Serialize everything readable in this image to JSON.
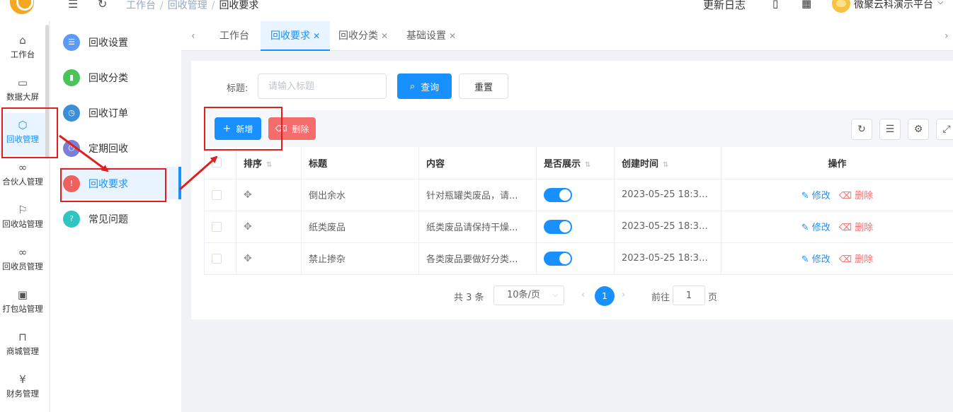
{
  "header": {
    "breadcrumbs": [
      "工作台",
      "回收管理",
      "回收要求"
    ],
    "right_items": {
      "changelog": "更新日志",
      "account": "微聚云科演示平台"
    }
  },
  "leftnav": {
    "items": [
      {
        "label": "工作台",
        "icon": "home-icon"
      },
      {
        "label": "数据大屏",
        "icon": "monitor-icon"
      },
      {
        "label": "回收管理",
        "icon": "cube-icon",
        "active": true
      },
      {
        "label": "合伙人管理",
        "icon": "link-icon"
      },
      {
        "label": "回收站管理",
        "icon": "flag-icon"
      },
      {
        "label": "回收员管理",
        "icon": "infinity-icon"
      },
      {
        "label": "打包站管理",
        "icon": "package-icon"
      },
      {
        "label": "商城管理",
        "icon": "bag-icon"
      },
      {
        "label": "财务管理",
        "icon": "yen-icon"
      }
    ]
  },
  "submenu": {
    "items": [
      {
        "label": "回收设置",
        "icon": "settings-icon",
        "color": "#5b9bf5"
      },
      {
        "label": "回收分类",
        "icon": "bookmark-icon",
        "color": "#4cc25a"
      },
      {
        "label": "回收订单",
        "icon": "clock-icon",
        "color": "#3a8fd8"
      },
      {
        "label": "定期回收",
        "icon": "power-icon",
        "color": "#7b7fd6"
      },
      {
        "label": "回收要求",
        "icon": "alert-icon",
        "color": "#f0605d",
        "active": true
      },
      {
        "label": "常见问题",
        "icon": "question-icon",
        "color": "#2ec5c2"
      }
    ]
  },
  "tabs": [
    {
      "label": "工作台",
      "closable": false
    },
    {
      "label": "回收要求",
      "closable": true,
      "active": true
    },
    {
      "label": "回收分类",
      "closable": true
    },
    {
      "label": "基础设置",
      "closable": true
    }
  ],
  "search": {
    "label": "标题:",
    "placeholder": "请输入标题",
    "query_label": "查询",
    "reset_label": "重置"
  },
  "actions": {
    "add_label": "新增",
    "delete_label": "删除"
  },
  "table": {
    "columns": [
      "排序",
      "标题",
      "内容",
      "是否展示",
      "创建时间",
      "操作"
    ],
    "rows": [
      {
        "title": "倒出余水",
        "content": "针对瓶罐类废品，请...",
        "show": true,
        "created": "2023-05-25 18:32:..."
      },
      {
        "title": "纸类废品",
        "content": "纸类废品请保持干燥...",
        "show": true,
        "created": "2023-05-25 18:30:..."
      },
      {
        "title": "禁止掺杂",
        "content": "各类废品要做好分类...",
        "show": true,
        "created": "2023-05-25 18:31:..."
      }
    ],
    "edit_label": "修改",
    "row_delete_label": "删除"
  },
  "pagination": {
    "total_text": "共 3 条",
    "page_size": "10条/页",
    "current_page": "1",
    "goto_label": "前往",
    "goto_value": "1",
    "page_suffix": "页"
  }
}
